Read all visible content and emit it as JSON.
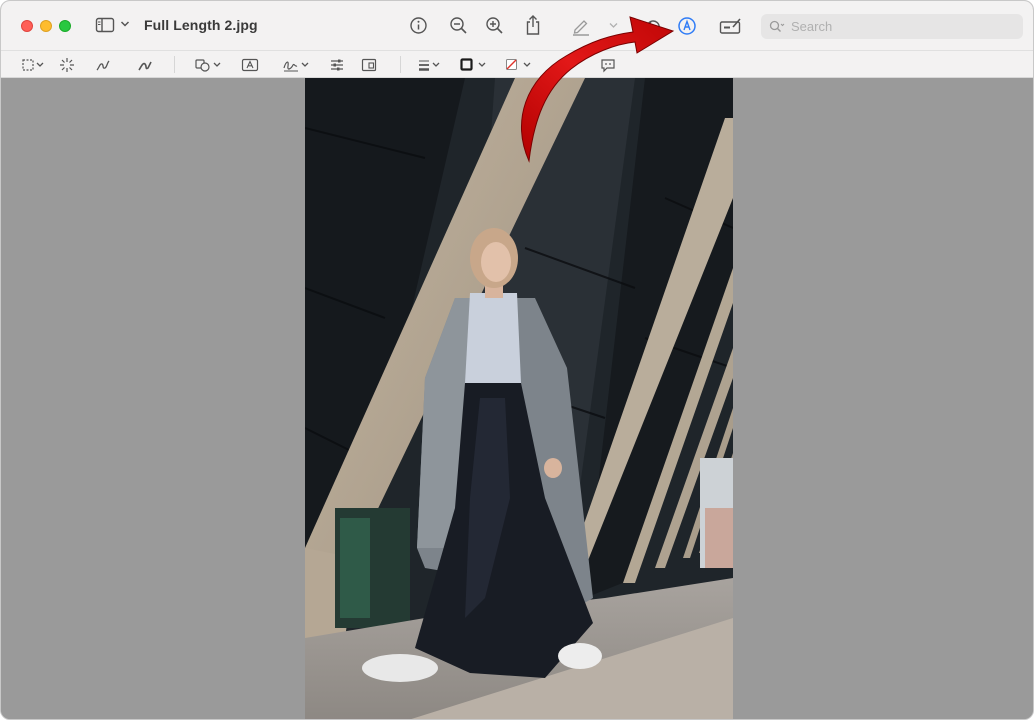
{
  "window": {
    "title": "Full Length 2.jpg"
  },
  "search": {
    "placeholder": "Search"
  },
  "toolbar": {
    "icons": [
      "sidebar-icon",
      "info-icon",
      "zoom-out-icon",
      "zoom-in-icon",
      "share-icon",
      "highlight-pen-icon",
      "rotate-icon",
      "markup-icon",
      "form-fill-icon"
    ]
  },
  "markup_toolbar": {
    "icons": [
      "rect-selection-icon",
      "instant-alpha-icon",
      "sketch-icon",
      "draw-icon",
      "shapes-icon",
      "text-icon",
      "sign-icon",
      "adjust-color-icon",
      "page-layout-icon",
      "line-style-icon",
      "border-color-icon",
      "fill-color-icon",
      "speech-bubble-icon"
    ]
  },
  "colors": {
    "accent": "#2f7cf6",
    "annotation_arrow": "#d40a0a",
    "canvas_background": "#9a9a9a"
  }
}
